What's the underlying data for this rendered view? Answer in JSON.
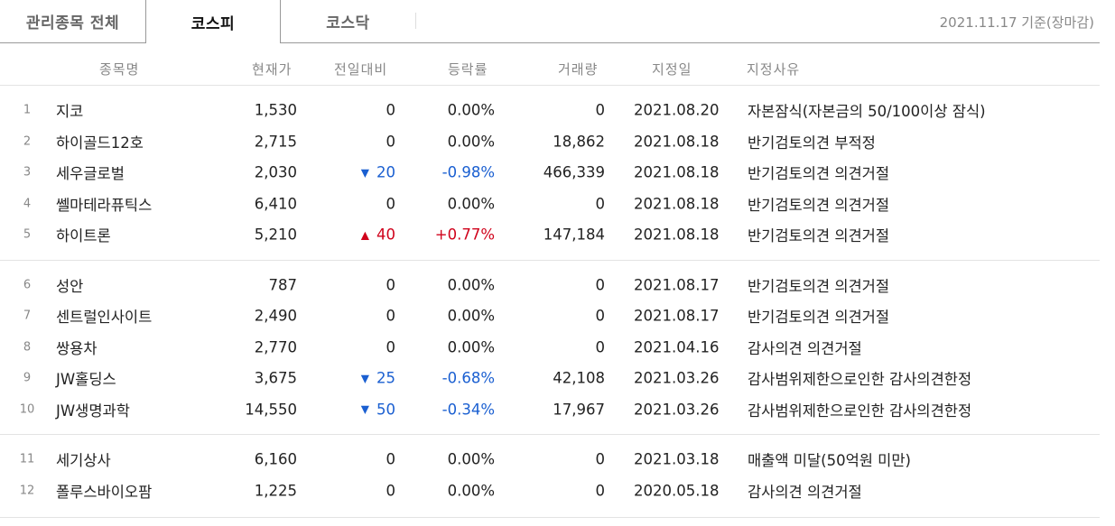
{
  "tabs": [
    {
      "label": "관리종목 전체"
    },
    {
      "label": "코스피"
    },
    {
      "label": "코스닥"
    }
  ],
  "as_of": "2021.11.17 기준(장마감)",
  "columns": {
    "name": "종목명",
    "price": "현재가",
    "change": "전일대비",
    "rate": "등락률",
    "volume": "거래량",
    "date": "지정일",
    "reason": "지정사유"
  },
  "groups": [
    [
      {
        "no": "1",
        "name": "지코",
        "price": "1,530",
        "change": "0",
        "dir": "",
        "rate": "0.00%",
        "volume": "0",
        "date": "2021.08.20",
        "reason": "자본잠식(자본금의 50/100이상 잠식)"
      },
      {
        "no": "2",
        "name": "하이골드12호",
        "price": "2,715",
        "change": "0",
        "dir": "",
        "rate": "0.00%",
        "volume": "18,862",
        "date": "2021.08.18",
        "reason": "반기검토의견 부적정"
      },
      {
        "no": "3",
        "name": "세우글로벌",
        "price": "2,030",
        "change": "20",
        "dir": "down",
        "rate": "-0.98%",
        "volume": "466,339",
        "date": "2021.08.18",
        "reason": "반기검토의견 의견거절"
      },
      {
        "no": "4",
        "name": "쎌마테라퓨틱스",
        "price": "6,410",
        "change": "0",
        "dir": "",
        "rate": "0.00%",
        "volume": "0",
        "date": "2021.08.18",
        "reason": "반기검토의견 의견거절"
      },
      {
        "no": "5",
        "name": "하이트론",
        "price": "5,210",
        "change": "40",
        "dir": "up",
        "rate": "+0.77%",
        "volume": "147,184",
        "date": "2021.08.18",
        "reason": "반기검토의견 의견거절"
      }
    ],
    [
      {
        "no": "6",
        "name": "성안",
        "price": "787",
        "change": "0",
        "dir": "",
        "rate": "0.00%",
        "volume": "0",
        "date": "2021.08.17",
        "reason": "반기검토의견 의견거절"
      },
      {
        "no": "7",
        "name": "센트럴인사이트",
        "price": "2,490",
        "change": "0",
        "dir": "",
        "rate": "0.00%",
        "volume": "0",
        "date": "2021.08.17",
        "reason": "반기검토의견 의견거절"
      },
      {
        "no": "8",
        "name": "쌍용차",
        "price": "2,770",
        "change": "0",
        "dir": "",
        "rate": "0.00%",
        "volume": "0",
        "date": "2021.04.16",
        "reason": "감사의견 의견거절"
      },
      {
        "no": "9",
        "name": "JW홀딩스",
        "price": "3,675",
        "change": "25",
        "dir": "down",
        "rate": "-0.68%",
        "volume": "42,108",
        "date": "2021.03.26",
        "reason": "감사범위제한으로인한 감사의견한정"
      },
      {
        "no": "10",
        "name": "JW생명과학",
        "price": "14,550",
        "change": "50",
        "dir": "down",
        "rate": "-0.34%",
        "volume": "17,967",
        "date": "2021.03.26",
        "reason": "감사범위제한으로인한 감사의견한정"
      }
    ],
    [
      {
        "no": "11",
        "name": "세기상사",
        "price": "6,160",
        "change": "0",
        "dir": "",
        "rate": "0.00%",
        "volume": "0",
        "date": "2021.03.18",
        "reason": "매출액 미달(50억원 미만)"
      },
      {
        "no": "12",
        "name": "폴루스바이오팜",
        "price": "1,225",
        "change": "0",
        "dir": "",
        "rate": "0.00%",
        "volume": "0",
        "date": "2020.05.18",
        "reason": "감사의견 의견거절"
      }
    ]
  ],
  "colors": {
    "down": "#1a5fd1",
    "up": "#d0021b"
  },
  "icons": {
    "down": "triangle-down-icon",
    "up": "triangle-up-icon"
  }
}
